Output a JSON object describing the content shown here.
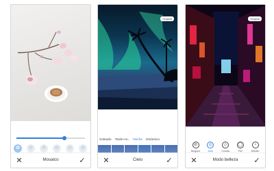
{
  "panels": {
    "mosaic": {
      "effect_strength": 0.7,
      "effects": [
        "effect-1",
        "effect-2",
        "effect-3",
        "effect-4",
        "effect-5",
        "effect-6"
      ],
      "selected_effect": 0,
      "title": "Mosaico",
      "close_icon": "✕",
      "confirm_icon": "✓"
    },
    "sky": {
      "badge": "Original",
      "tabs": [
        "Soleado",
        "Tarde-no..",
        "Noche",
        "Dinámico"
      ],
      "active_tab": 2,
      "frames": 6,
      "selected_frame": 3,
      "title": "Cielo",
      "close_icon": "✕",
      "confirm_icon": "✓"
    },
    "beauty": {
      "badge": "Original",
      "options": [
        {
          "label": "Ninguno",
          "icon": "⊘"
        },
        {
          "label": "Auto",
          "icon": "◎"
        },
        {
          "label": "Corrida",
          "icon": "◇"
        },
        {
          "label": "Piel",
          "icon": "◯"
        },
        {
          "label": "Retrato",
          "icon": "◔"
        }
      ],
      "active_option": 1,
      "title": "Modo belleza",
      "close_icon": "✕",
      "confirm_icon": "✓"
    }
  },
  "colors": {
    "accent": "#2f7fd8"
  }
}
